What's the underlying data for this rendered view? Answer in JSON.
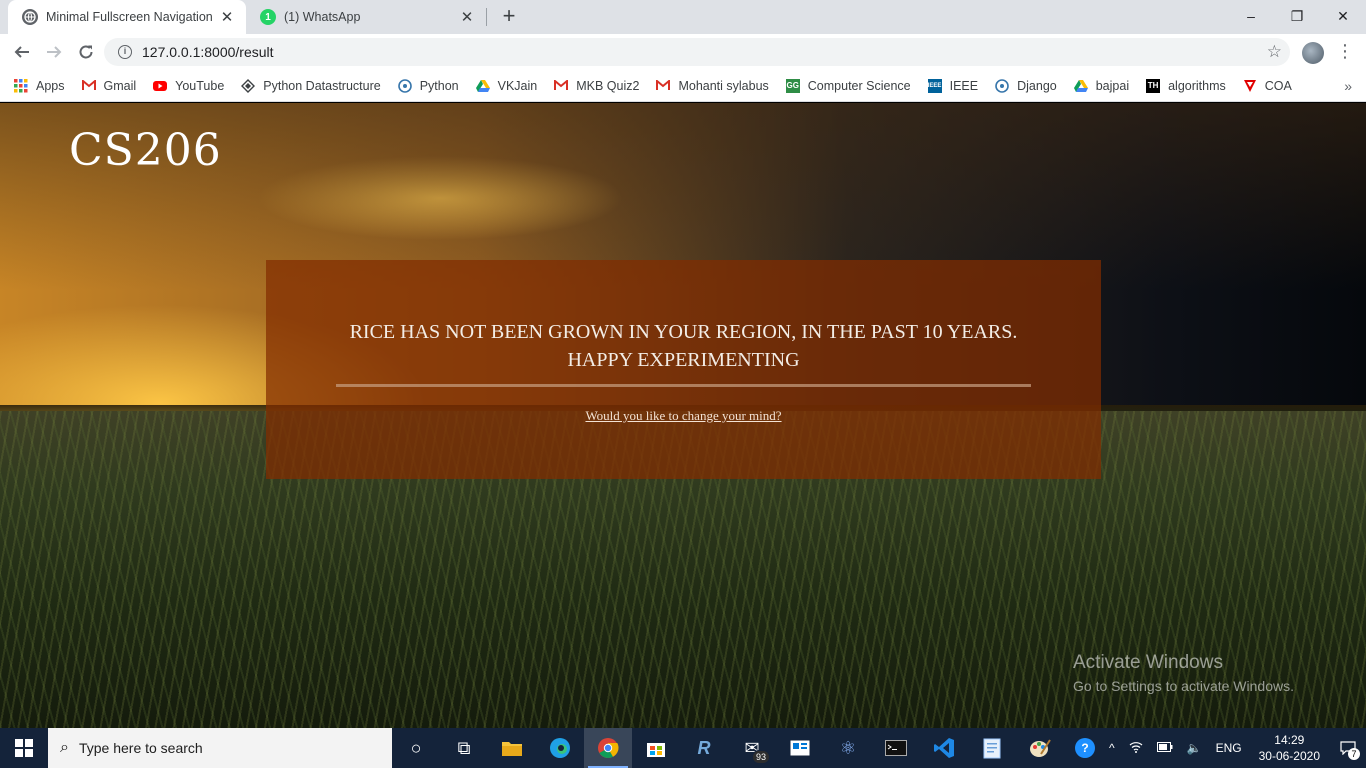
{
  "browser": {
    "tabs": [
      {
        "title": "Minimal Fullscreen Navigation",
        "favicon": "globe-icon",
        "active": true
      },
      {
        "title": "(1) WhatsApp",
        "favicon": "whatsapp-icon",
        "active": false
      }
    ],
    "new_tab": "+",
    "window_controls": {
      "minimize": "–",
      "restore": "❐",
      "close": "✕"
    },
    "address": {
      "url": "127.0.0.1:8000/result",
      "info_icon": "info-icon",
      "bookmark_icon": "star-icon"
    },
    "bookmarks": [
      {
        "label": "Apps",
        "icon": "apps-grid-icon",
        "color": "#4285f4"
      },
      {
        "label": "Gmail",
        "icon": "gmail-icon",
        "color": "#d93025"
      },
      {
        "label": "YouTube",
        "icon": "youtube-icon",
        "color": "#ff0000"
      },
      {
        "label": "Python Datastructure",
        "icon": "diamond-icon",
        "color": "#3c4043"
      },
      {
        "label": "Python",
        "icon": "python-icon",
        "color": "#3776ab"
      },
      {
        "label": "VKJain",
        "icon": "drive-icon",
        "color": "#0f9d58"
      },
      {
        "label": "MKB Quiz2",
        "icon": "gmail-icon",
        "color": "#d93025"
      },
      {
        "label": "Mohanti sylabus",
        "icon": "gmail-icon",
        "color": "#d93025"
      },
      {
        "label": "Computer Science",
        "icon": "gfg-icon",
        "color": "#2f8d46"
      },
      {
        "label": "IEEE",
        "icon": "ieee-icon",
        "color": "#00629b"
      },
      {
        "label": "Django",
        "icon": "django-icon",
        "color": "#3776ab"
      },
      {
        "label": "bajpai",
        "icon": "drive-icon",
        "color": "#0f9d58"
      },
      {
        "label": "algorithms",
        "icon": "th-icon",
        "color": "#000000"
      },
      {
        "label": "COA",
        "icon": "coa-icon",
        "color": "#e00000"
      }
    ],
    "more": "»"
  },
  "page": {
    "brand": "CS206",
    "message_line1": "RICE HAS NOT BEEN GROWN IN YOUR REGION, IN THE PAST 10 YEARS.",
    "message_line2": "HAPPY EXPERIMENTING",
    "change_link": "Would you like to change your mind?",
    "activate_title": "Activate Windows",
    "activate_sub": "Go to Settings to activate Windows."
  },
  "taskbar": {
    "search_placeholder": "Type here to search",
    "apps": [
      {
        "name": "cortana-icon",
        "glyph": "○",
        "color": "#ffffff"
      },
      {
        "name": "task-view-icon",
        "glyph": "⧉",
        "color": "#ffffff"
      },
      {
        "name": "file-explorer-icon",
        "glyph": "",
        "color": "#f5c33b"
      },
      {
        "name": "edge-icon",
        "glyph": "",
        "color": "#1fa0e6"
      },
      {
        "name": "chrome-icon",
        "glyph": "",
        "color": "#e8453c",
        "active": true
      },
      {
        "name": "store-icon",
        "glyph": "",
        "color": "#ffffff"
      },
      {
        "name": "rstudio-icon",
        "glyph": "R",
        "color": "#75aadb"
      },
      {
        "name": "mail-icon",
        "glyph": "✉",
        "color": "#ffffff",
        "badge": "93"
      },
      {
        "name": "news-icon",
        "glyph": "",
        "color": "#ffffff"
      },
      {
        "name": "network-app-icon",
        "glyph": "⚛",
        "color": "#8ab4f8"
      },
      {
        "name": "terminal-icon",
        "glyph": "",
        "color": "#111111"
      },
      {
        "name": "vscode-icon",
        "glyph": "",
        "color": "#1e88e5"
      },
      {
        "name": "notepad-icon",
        "glyph": "",
        "color": "#9ec9ff"
      },
      {
        "name": "paint-icon",
        "glyph": "",
        "color": "#f0c060"
      }
    ],
    "tray": {
      "help": "?",
      "chevron": "^",
      "lang": "ENG",
      "time": "14:29",
      "date": "30-06-2020",
      "notification_count": "7"
    }
  }
}
